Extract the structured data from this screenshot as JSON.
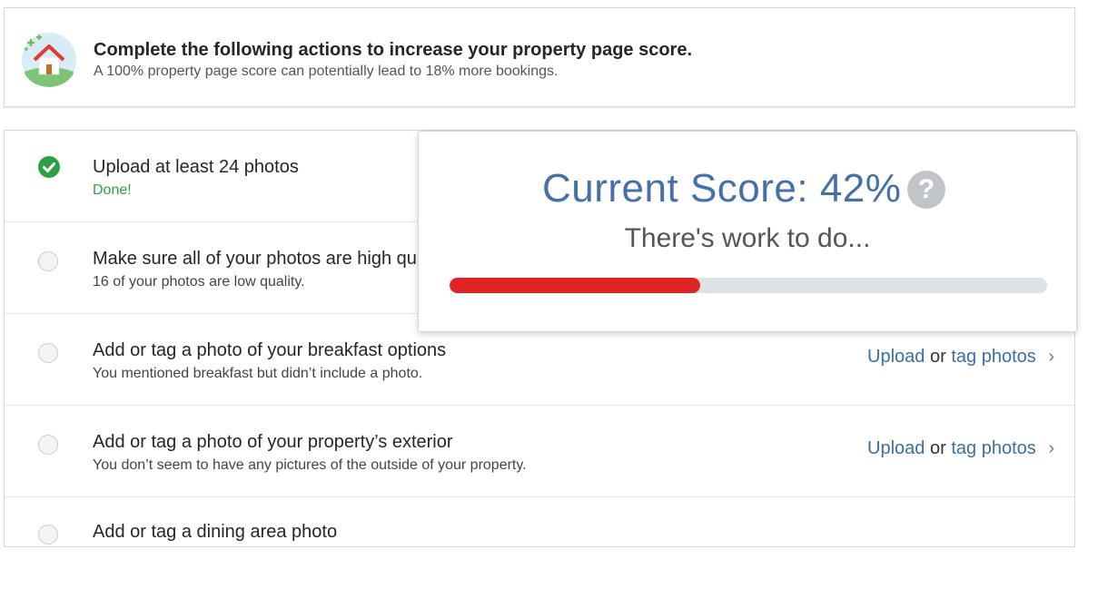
{
  "banner": {
    "title": "Complete the following actions to increase your property page score.",
    "subtitle": "A 100% property page score can potentially lead to 18% more bookings."
  },
  "tasks": [
    {
      "title": "Upload at least 24 photos",
      "subtitle": "Done!",
      "status": "done"
    },
    {
      "title": "Make sure all of your photos are high quality",
      "subtitle": "16 of your photos are low quality.",
      "status": "todo"
    },
    {
      "title": "Add or tag a photo of your breakfast options",
      "subtitle": "You mentioned breakfast but didn’t include a photo.",
      "status": "todo",
      "action_upload": "Upload",
      "action_or": "or",
      "action_tag": "tag photos"
    },
    {
      "title": "Add or tag a photo of your property’s exterior",
      "subtitle": "You don’t seem to have any pictures of the outside of your property.",
      "status": "todo",
      "action_upload": "Upload",
      "action_or": "or",
      "action_tag": "tag photos"
    },
    {
      "title": "Add or tag a dining area photo",
      "subtitle": "",
      "status": "todo"
    }
  ],
  "score_popup": {
    "score_text": "Current Score: 42%",
    "score_value": 42,
    "message": "There's work to do...",
    "help_icon": "?"
  },
  "colors": {
    "done_green": "#2ea043",
    "score_blue": "#4670a8",
    "progress_red": "#e02424",
    "link_blue": "#3a6ea5"
  },
  "icons": {
    "banner": "house-icon",
    "done": "check-circle-icon",
    "todo": "radio-circle-icon",
    "chevron": "chevron-right-icon",
    "help": "question-circle-icon"
  }
}
